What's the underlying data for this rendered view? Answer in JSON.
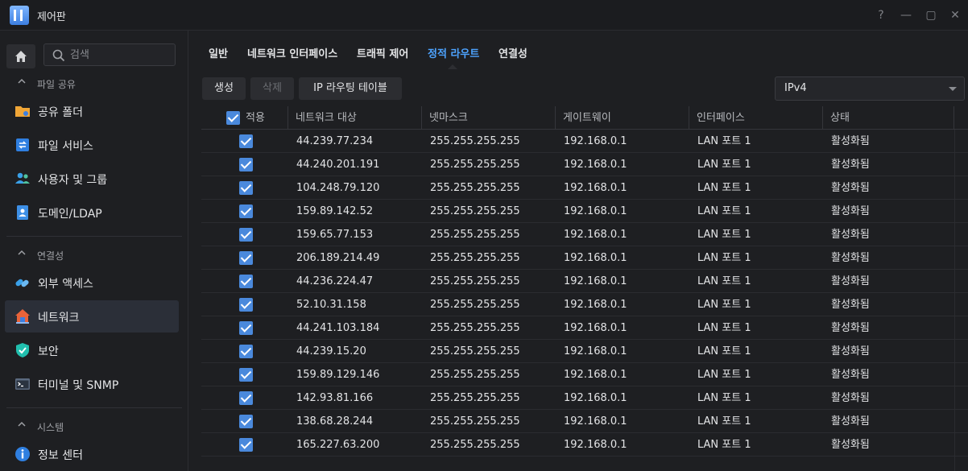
{
  "window": {
    "title": "제어판",
    "buttons": {
      "help": "?",
      "minimize": "—",
      "restore": "▢",
      "close": "✕"
    }
  },
  "sidebar": {
    "search_placeholder": "검색",
    "sections": [
      {
        "label": "파일 공유",
        "items": [
          {
            "label": "공유 폴더",
            "icon": "folder-share-icon"
          },
          {
            "label": "파일 서비스",
            "icon": "file-services-icon"
          },
          {
            "label": "사용자 및 그룹",
            "icon": "users-groups-icon"
          },
          {
            "label": "도메인/LDAP",
            "icon": "domain-ldap-icon"
          }
        ]
      },
      {
        "label": "연결성",
        "items": [
          {
            "label": "외부 액세스",
            "icon": "external-access-icon"
          },
          {
            "label": "네트워크",
            "icon": "network-icon",
            "active": true
          },
          {
            "label": "보안",
            "icon": "security-shield-icon"
          },
          {
            "label": "터미널 및 SNMP",
            "icon": "terminal-icon"
          }
        ]
      },
      {
        "label": "시스템",
        "items": [
          {
            "label": "정보 센터",
            "icon": "info-center-icon"
          }
        ]
      }
    ]
  },
  "tabs": [
    {
      "label": "일반"
    },
    {
      "label": "네트워크 인터페이스"
    },
    {
      "label": "트래픽 제어"
    },
    {
      "label": "정적 라우트",
      "active": true
    },
    {
      "label": "연결성"
    }
  ],
  "toolbar": {
    "create": "생성",
    "delete": "삭제",
    "ip_routing_table": "IP 라우팅 테이블",
    "ip_version": "IPv4"
  },
  "table": {
    "columns": [
      "적용",
      "네트워크 대상",
      "넷마스크",
      "게이트웨이",
      "인터페이스",
      "상태"
    ],
    "rows": [
      {
        "enabled": true,
        "destination": "44.239.77.234",
        "netmask": "255.255.255.255",
        "gateway": "192.168.0.1",
        "interface": "LAN 포트 1",
        "status": "활성화됨"
      },
      {
        "enabled": true,
        "destination": "44.240.201.191",
        "netmask": "255.255.255.255",
        "gateway": "192.168.0.1",
        "interface": "LAN 포트 1",
        "status": "활성화됨"
      },
      {
        "enabled": true,
        "destination": "104.248.79.120",
        "netmask": "255.255.255.255",
        "gateway": "192.168.0.1",
        "interface": "LAN 포트 1",
        "status": "활성화됨"
      },
      {
        "enabled": true,
        "destination": "159.89.142.52",
        "netmask": "255.255.255.255",
        "gateway": "192.168.0.1",
        "interface": "LAN 포트 1",
        "status": "활성화됨"
      },
      {
        "enabled": true,
        "destination": "159.65.77.153",
        "netmask": "255.255.255.255",
        "gateway": "192.168.0.1",
        "interface": "LAN 포트 1",
        "status": "활성화됨"
      },
      {
        "enabled": true,
        "destination": "206.189.214.49",
        "netmask": "255.255.255.255",
        "gateway": "192.168.0.1",
        "interface": "LAN 포트 1",
        "status": "활성화됨"
      },
      {
        "enabled": true,
        "destination": "44.236.224.47",
        "netmask": "255.255.255.255",
        "gateway": "192.168.0.1",
        "interface": "LAN 포트 1",
        "status": "활성화됨"
      },
      {
        "enabled": true,
        "destination": "52.10.31.158",
        "netmask": "255.255.255.255",
        "gateway": "192.168.0.1",
        "interface": "LAN 포트 1",
        "status": "활성화됨"
      },
      {
        "enabled": true,
        "destination": "44.241.103.184",
        "netmask": "255.255.255.255",
        "gateway": "192.168.0.1",
        "interface": "LAN 포트 1",
        "status": "활성화됨"
      },
      {
        "enabled": true,
        "destination": "44.239.15.20",
        "netmask": "255.255.255.255",
        "gateway": "192.168.0.1",
        "interface": "LAN 포트 1",
        "status": "활성화됨"
      },
      {
        "enabled": true,
        "destination": "159.89.129.146",
        "netmask": "255.255.255.255",
        "gateway": "192.168.0.1",
        "interface": "LAN 포트 1",
        "status": "활성화됨"
      },
      {
        "enabled": true,
        "destination": "142.93.81.166",
        "netmask": "255.255.255.255",
        "gateway": "192.168.0.1",
        "interface": "LAN 포트 1",
        "status": "활성화됨"
      },
      {
        "enabled": true,
        "destination": "138.68.28.244",
        "netmask": "255.255.255.255",
        "gateway": "192.168.0.1",
        "interface": "LAN 포트 1",
        "status": "활성화됨"
      },
      {
        "enabled": true,
        "destination": "165.227.63.200",
        "netmask": "255.255.255.255",
        "gateway": "192.168.0.1",
        "interface": "LAN 포트 1",
        "status": "활성화됨"
      }
    ]
  },
  "colors": {
    "accent": "#4da3ff",
    "checkbox": "#4a89dc",
    "background": "#1e1f22"
  }
}
